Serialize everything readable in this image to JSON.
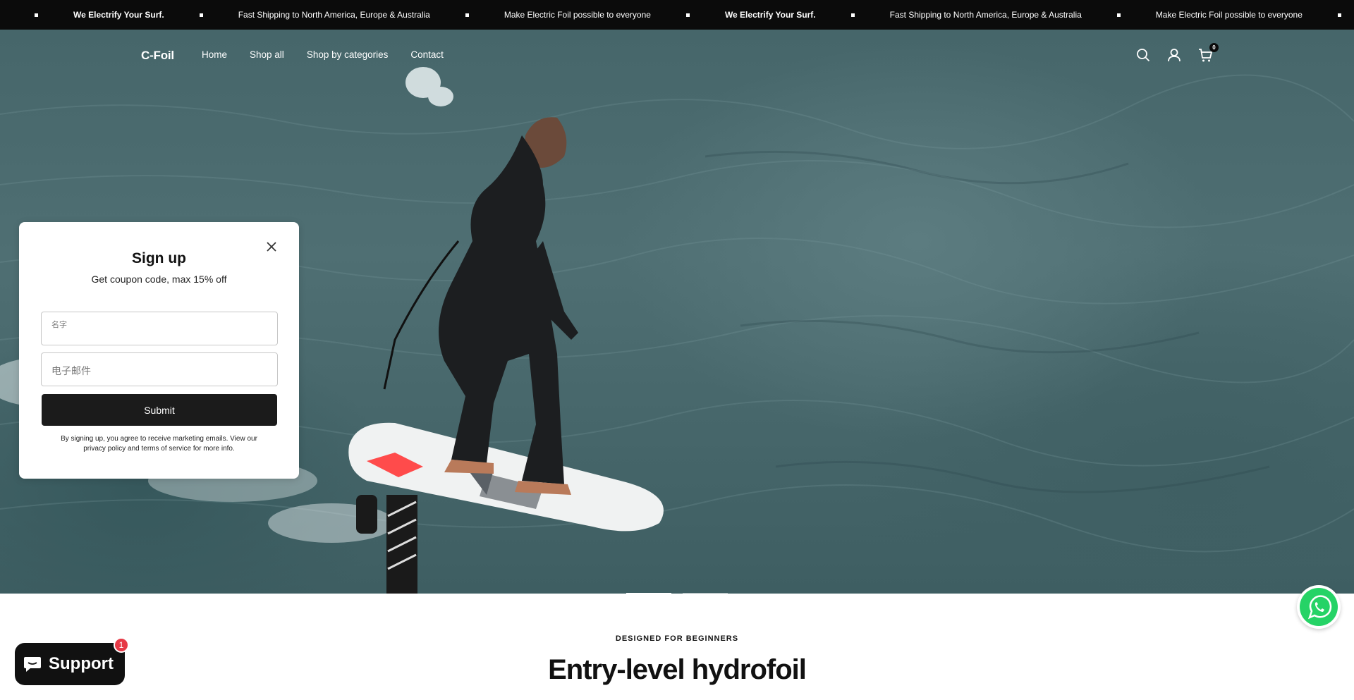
{
  "announcement": {
    "items": [
      {
        "text": "We Electrify Your Surf.",
        "bold": true
      },
      {
        "text": "Fast Shipping to North America, Europe & Australia",
        "bold": false
      },
      {
        "text": "Make Electric Foil possible to everyone",
        "bold": false
      },
      {
        "text": "We Electrify Your Surf.",
        "bold": true
      },
      {
        "text": "Fast Shipping to North America, Europe & Australia",
        "bold": false
      },
      {
        "text": "Make Electric Foil possible to everyone",
        "bold": false
      }
    ]
  },
  "header": {
    "logo": "C-Foil",
    "nav": [
      {
        "label": "Home"
      },
      {
        "label": "Shop all"
      },
      {
        "label": "Shop by categories"
      },
      {
        "label": "Contact"
      }
    ],
    "icons": [
      "search-icon",
      "account-icon",
      "cart-icon"
    ],
    "cart_count": "0"
  },
  "hero": {
    "slides_total": 2,
    "active_slide": 1
  },
  "popup": {
    "title": "Sign up",
    "subtitle": "Get coupon code, max 15% off",
    "name_placeholder": "名字",
    "email_placeholder": "电子邮件",
    "submit_label": "Submit",
    "legal": "By signing up, you agree to receive marketing emails. View our privacy policy and terms of service for more info."
  },
  "section": {
    "eyebrow": "DESIGNED FOR BEGINNERS",
    "title": "Entry-level hydrofoil"
  },
  "support": {
    "label": "Support",
    "badge": "1"
  },
  "colors": {
    "announcement_bg": "#0b0b0b",
    "submit_bg": "#1b1b1b",
    "badge": "#e63946",
    "whatsapp": "#25d366"
  }
}
